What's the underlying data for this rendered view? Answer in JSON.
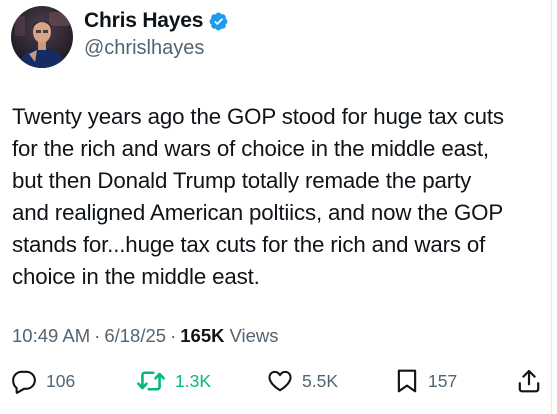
{
  "author": {
    "display_name": "Chris Hayes",
    "handle": "@chrislhayes",
    "verified": true
  },
  "tweet": {
    "text": "Twenty years ago the GOP stood for huge tax cuts\nfor the rich and wars of choice in the middle east,\nbut then Donald Trump totally remade the party\nand realigned American poltiics, and now the GOP\nstands for...huge tax cuts for the rich and wars of\nchoice in the middle east."
  },
  "meta": {
    "time": "10:49 AM",
    "separator": "·",
    "date": "6/18/25",
    "views_count": "165K",
    "views_label": "Views"
  },
  "actions": {
    "replies": {
      "icon": "reply-icon",
      "count": "106"
    },
    "reposts": {
      "icon": "retweet-icon",
      "count": "1.3K",
      "color": "#00ba7c"
    },
    "likes": {
      "icon": "heart-icon",
      "count": "5.5K"
    },
    "bookmarks": {
      "icon": "bookmark-icon",
      "count": "157"
    },
    "share": {
      "icon": "share-icon"
    }
  },
  "colors": {
    "text": "#0f1419",
    "secondary": "#536471",
    "verified": "#1d9bf0",
    "repost_active": "#00ba7c"
  }
}
